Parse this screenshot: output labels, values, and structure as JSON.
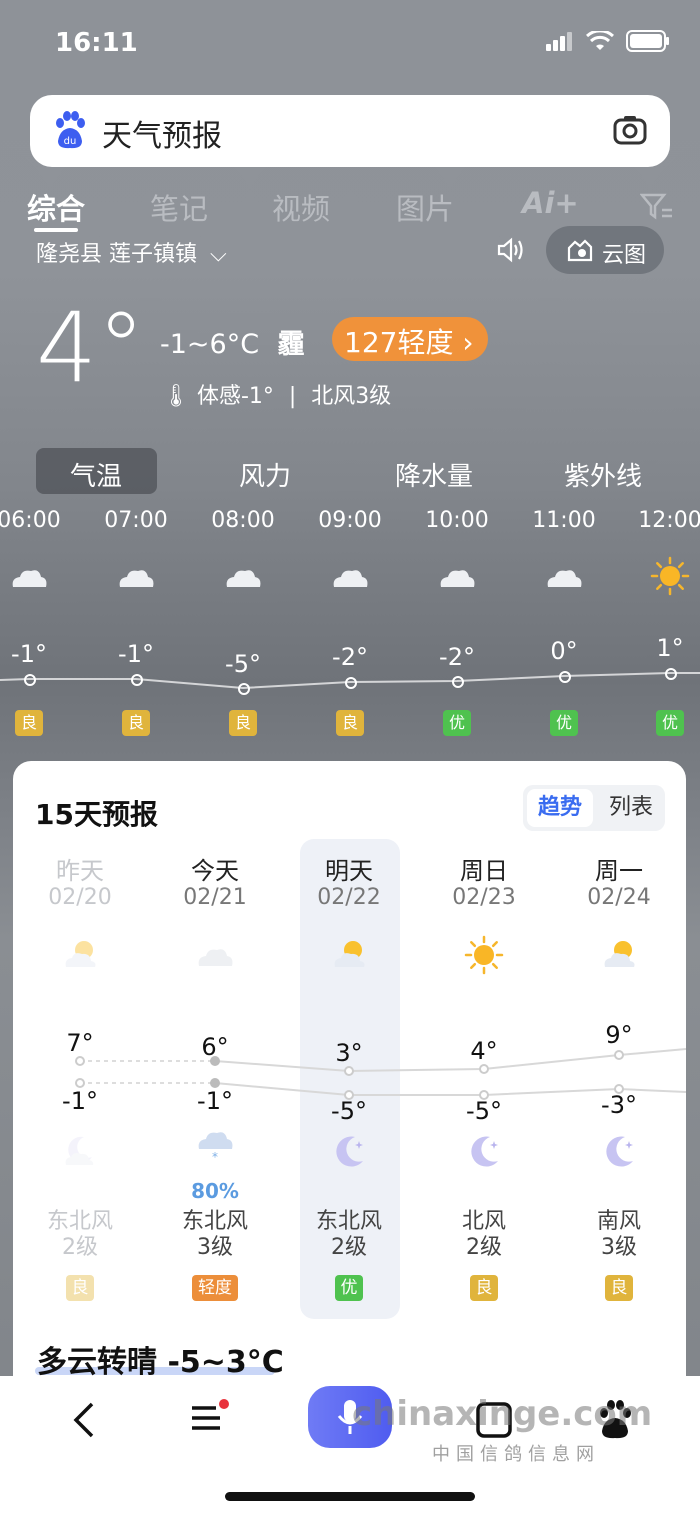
{
  "status": {
    "time": "16:11"
  },
  "search": {
    "query": "天气预报"
  },
  "tabs": [
    "综合",
    "笔记",
    "视频",
    "图片",
    "Ai+"
  ],
  "location": "隆尧县 莲子镇镇",
  "cloud_map_label": "云图",
  "current": {
    "temp": "4°",
    "range": "-1~6°C",
    "condition": "霾",
    "aqi": "127轻度 ›",
    "feel": "体感-1°",
    "wind": "北风3级"
  },
  "metric_tabs": [
    "气温",
    "风力",
    "降水量",
    "紫外线"
  ],
  "hourly": [
    {
      "time": "06:00",
      "temp": "-1°",
      "icon": "cloud-icon",
      "aq": "良",
      "aq_color": "#e0b43c"
    },
    {
      "time": "07:00",
      "temp": "-1°",
      "icon": "cloud-icon",
      "aq": "良",
      "aq_color": "#e0b43c"
    },
    {
      "time": "08:00",
      "temp": "-5°",
      "icon": "cloud-icon",
      "aq": "良",
      "aq_color": "#e0b43c"
    },
    {
      "time": "09:00",
      "temp": "-2°",
      "icon": "cloud-icon",
      "aq": "良",
      "aq_color": "#e0b43c"
    },
    {
      "time": "10:00",
      "temp": "-2°",
      "icon": "cloud-icon",
      "aq": "优",
      "aq_color": "#4fc24f"
    },
    {
      "time": "11:00",
      "temp": "0°",
      "icon": "cloud-icon",
      "aq": "优",
      "aq_color": "#4fc24f"
    },
    {
      "time": "12:00",
      "temp": "1°",
      "icon": "sun-icon",
      "aq": "优",
      "aq_color": "#4fc24f"
    }
  ],
  "forecast": {
    "title": "15天预报",
    "toggle": [
      "趋势",
      "列表"
    ],
    "days": [
      {
        "name": "昨天",
        "date": "02/20",
        "hi": "7°",
        "lo": "-1°",
        "wind1": "东北风",
        "wind2": "2级",
        "aq": "良",
        "aq_color": "#f3e1ae",
        "day_icon": "partly-sunny-icon",
        "night_icon": "moon-cloud-icon",
        "precip": ""
      },
      {
        "name": "今天",
        "date": "02/21",
        "hi": "6°",
        "lo": "-1°",
        "wind1": "东北风",
        "wind2": "3级",
        "aq": "轻度",
        "aq_color": "#ec8e3a",
        "day_icon": "cloud-icon",
        "night_icon": "snow-cloud-icon",
        "precip": "80%"
      },
      {
        "name": "明天",
        "date": "02/22",
        "hi": "3°",
        "lo": "-5°",
        "wind1": "东北风",
        "wind2": "2级",
        "aq": "优",
        "aq_color": "#4fc24f",
        "day_icon": "partly-sunny-icon",
        "night_icon": "moon-icon",
        "precip": ""
      },
      {
        "name": "周日",
        "date": "02/23",
        "hi": "4°",
        "lo": "-5°",
        "wind1": "北风",
        "wind2": "2级",
        "aq": "良",
        "aq_color": "#e0b43c",
        "day_icon": "sun-icon",
        "night_icon": "moon-icon",
        "precip": ""
      },
      {
        "name": "周一",
        "date": "02/24",
        "hi": "9°",
        "lo": "-3°",
        "wind1": "南风",
        "wind2": "3级",
        "aq": "良",
        "aq_color": "#e0b43c",
        "day_icon": "partly-sunny-icon",
        "night_icon": "moon-icon",
        "precip": ""
      }
    ],
    "summary": "多云转晴 -5~3°C"
  },
  "watermark": {
    "main": "chinaxinge.com",
    "sub": "中国信鸽信息网"
  }
}
